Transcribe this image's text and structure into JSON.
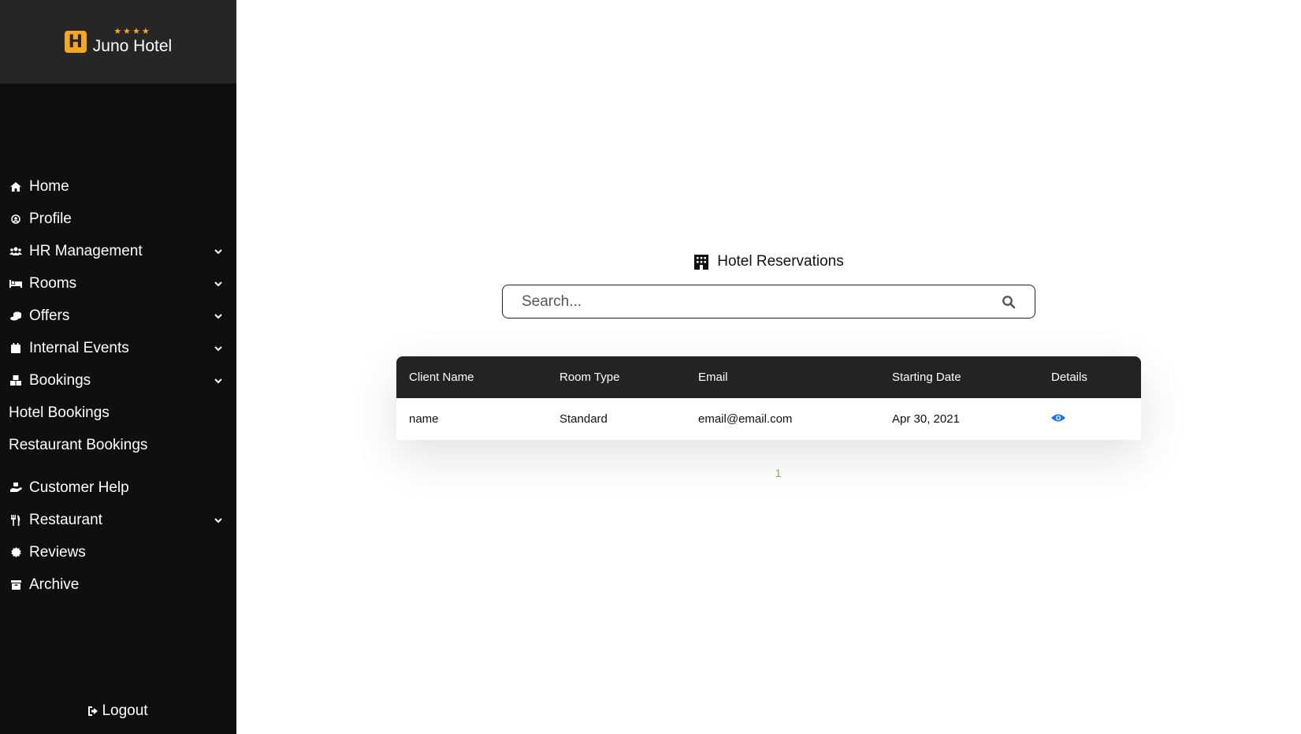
{
  "brand": {
    "name": "Juno Hotel",
    "logo_letter": "H",
    "stars": "★★★★"
  },
  "sidebar": {
    "items": [
      {
        "label": "Home",
        "icon": "home-icon",
        "glyph": "⌂",
        "dropdown": false
      },
      {
        "label": "Profile",
        "icon": "user-circle-icon",
        "glyph": "◎",
        "dropdown": false
      },
      {
        "label": "HR Management",
        "icon": "users-icon",
        "glyph": "👥",
        "dropdown": true
      },
      {
        "label": "Rooms",
        "icon": "bed-icon",
        "glyph": "🛏",
        "dropdown": true
      },
      {
        "label": "Offers",
        "icon": "coins-icon",
        "glyph": "⛁",
        "dropdown": true
      },
      {
        "label": "Internal Events",
        "icon": "calendar-icon",
        "glyph": "▦",
        "dropdown": true
      },
      {
        "label": "Bookings",
        "icon": "boxes-icon",
        "glyph": "▣",
        "dropdown": true
      }
    ],
    "sub_items": [
      "Hotel Bookings",
      "Restaurant Bookings"
    ],
    "items2": [
      {
        "label": "Customer Help",
        "icon": "hand-holding-icon",
        "glyph": "✋",
        "dropdown": false
      },
      {
        "label": "Restaurant",
        "icon": "utensils-icon",
        "glyph": "🍴",
        "dropdown": true
      },
      {
        "label": "Reviews",
        "icon": "certificate-icon",
        "glyph": "✹",
        "dropdown": false
      },
      {
        "label": "Archive",
        "icon": "archive-icon",
        "glyph": "▤",
        "dropdown": false
      }
    ],
    "logout": "Logout"
  },
  "main": {
    "title": "Hotel Reservations",
    "search": {
      "placeholder": "Search..."
    },
    "table": {
      "headers": [
        "Client Name",
        "Room Type",
        "Email",
        "Starting Date",
        "Details"
      ],
      "rows": [
        {
          "client": "name",
          "room": "Standard",
          "email": "email@email.com",
          "date": "Apr 30, 2021"
        }
      ]
    },
    "pagination": {
      "current": "1"
    }
  },
  "colors": {
    "accent": "#f5a623",
    "sidebar_bg": "#0f0f0f",
    "header_bg": "#232323",
    "link": "#1a73e8",
    "page_green": "#7cb342"
  }
}
